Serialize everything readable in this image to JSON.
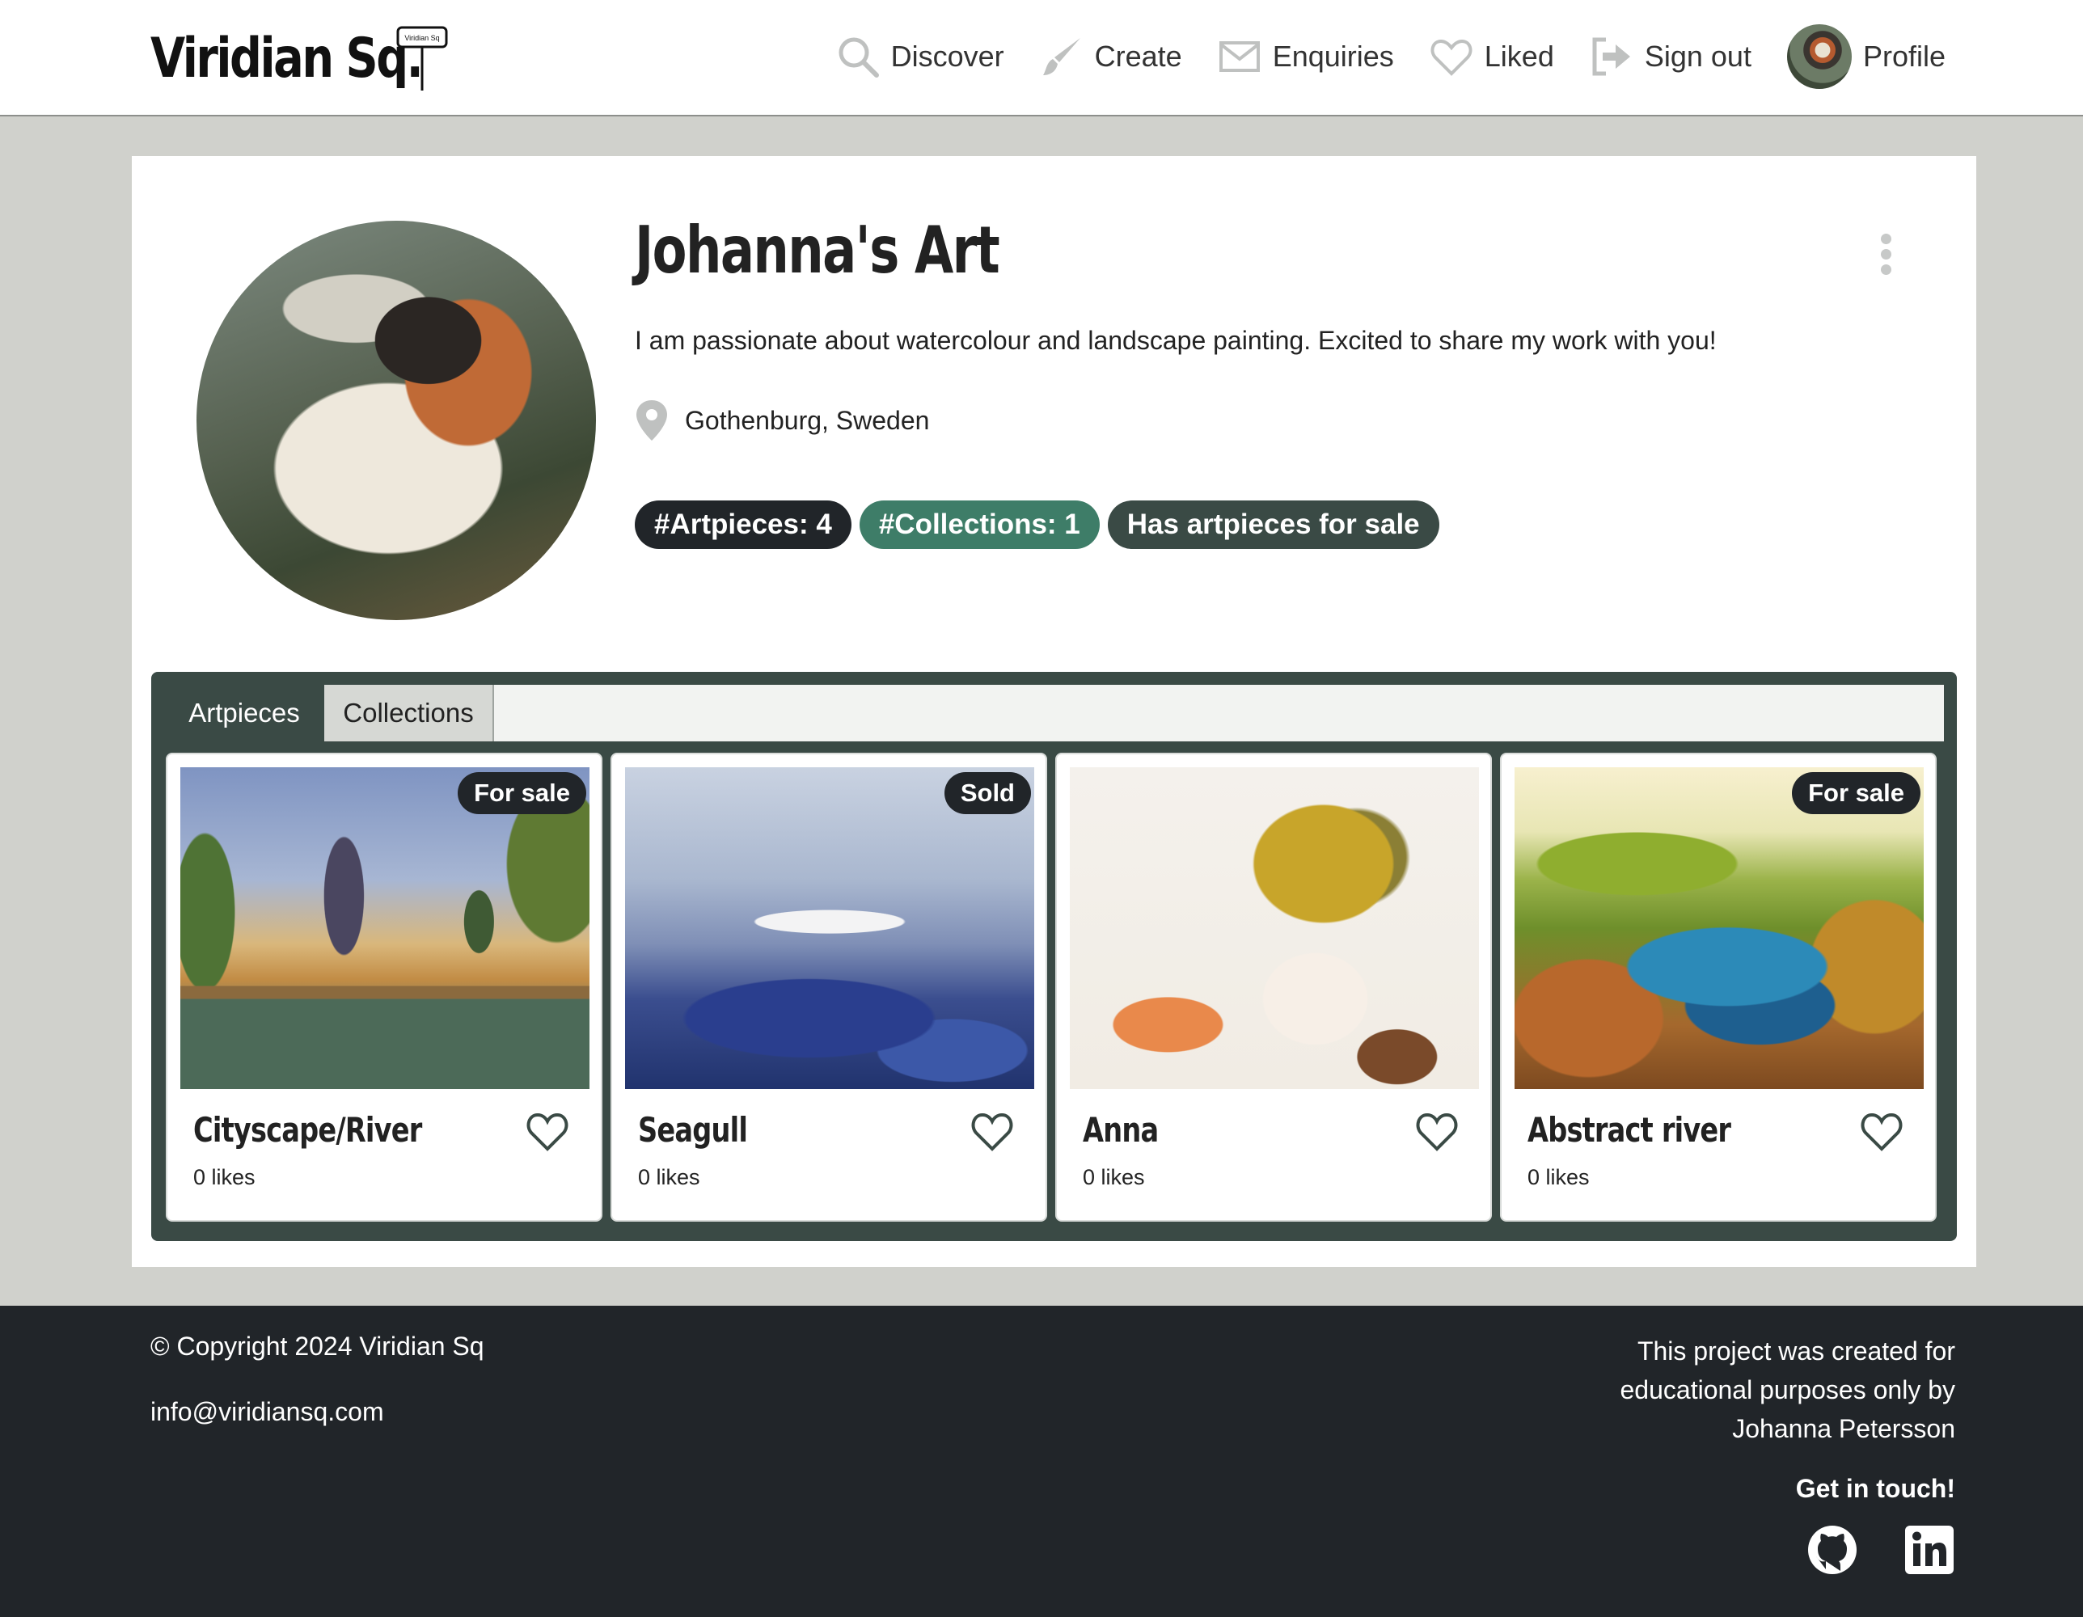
{
  "nav": {
    "brand": "Viridian Sq.",
    "brand_sign_text": "Viridian Sq",
    "items": [
      {
        "label": "Discover",
        "icon": "search-icon"
      },
      {
        "label": "Create",
        "icon": "brush-icon"
      },
      {
        "label": "Enquiries",
        "icon": "envelope-icon"
      },
      {
        "label": "Liked",
        "icon": "heart-icon"
      },
      {
        "label": "Sign out",
        "icon": "sign-out-icon"
      },
      {
        "label": "Profile",
        "icon": "avatar"
      }
    ]
  },
  "profile": {
    "name": "Johanna's Art",
    "bio": "I am passionate about watercolour and landscape painting. Excited to share my work with you!",
    "location": "Gothenburg, Sweden",
    "badges": {
      "artpieces": "#Artpieces: 4",
      "collections": "#Collections: 1",
      "for_sale": "Has artpieces for sale"
    }
  },
  "tabs": {
    "artpieces": "Artpieces",
    "collections": "Collections",
    "active": "Artpieces"
  },
  "artpieces": [
    {
      "title": "Cityscape/River",
      "likes": "0 likes",
      "status": "For sale"
    },
    {
      "title": "Seagull",
      "likes": "0 likes",
      "status": "Sold"
    },
    {
      "title": "Anna",
      "likes": "0 likes",
      "status": ""
    },
    {
      "title": "Abstract river",
      "likes": "0 likes",
      "status": "For sale"
    }
  ],
  "footer": {
    "copyright": "© Copyright 2024 Viridian Sq",
    "email": "info@viridiansq.com",
    "note": "This project was created for educational purposes only by Johanna Petersson",
    "get_in_touch": "Get in touch!",
    "icons": [
      "github-icon",
      "linkedin-icon"
    ]
  },
  "colors": {
    "page_bg": "#d0d1cc",
    "dark": "#212529",
    "green": "#3e7d68",
    "slate": "#3a4a45"
  }
}
